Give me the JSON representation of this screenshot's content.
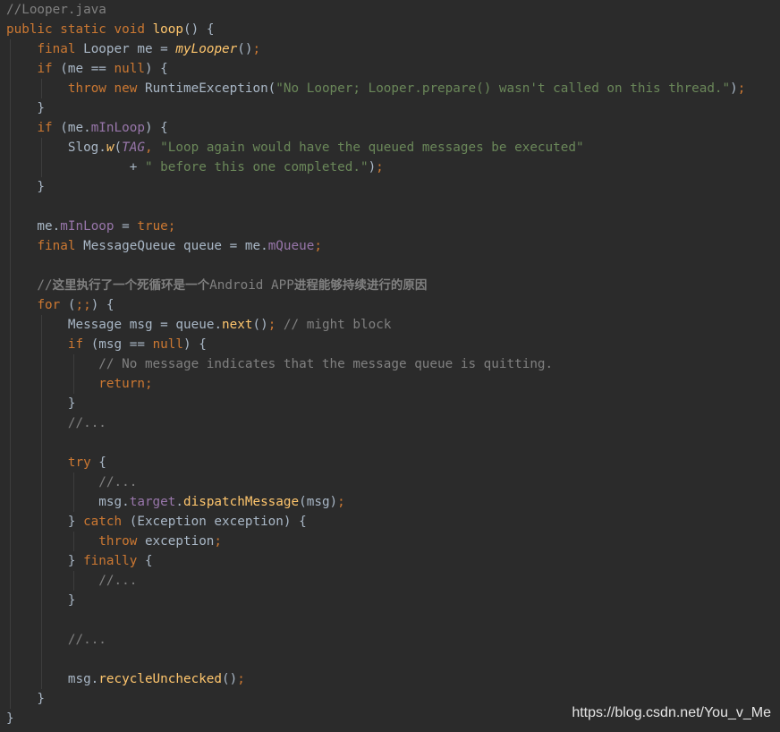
{
  "editor": {
    "file_comment": "//Looper.java",
    "lines": [
      [
        [
          "//Looper.java",
          "cm"
        ]
      ],
      [
        [
          "public",
          "kw"
        ],
        [
          " ",
          "p"
        ],
        [
          "static",
          "kw"
        ],
        [
          " ",
          "p"
        ],
        [
          "void",
          "kw"
        ],
        [
          " ",
          "p"
        ],
        [
          "loop",
          "fn"
        ],
        [
          "() {",
          "p"
        ]
      ],
      [
        [
          "    ",
          "p"
        ],
        [
          "final",
          "kw"
        ],
        [
          " Looper ",
          "cls"
        ],
        [
          "me",
          "lv"
        ],
        [
          " = ",
          "p"
        ],
        [
          "myLooper",
          "fni"
        ],
        [
          "()",
          "p"
        ],
        [
          ";",
          "kw"
        ]
      ],
      [
        [
          "    ",
          "p"
        ],
        [
          "if",
          "kw"
        ],
        [
          " (me == ",
          "p"
        ],
        [
          "null",
          "kw"
        ],
        [
          ") {",
          "p"
        ]
      ],
      [
        [
          "        ",
          "p"
        ],
        [
          "throw",
          "kw"
        ],
        [
          " ",
          "p"
        ],
        [
          "new",
          "kw"
        ],
        [
          " RuntimeException(",
          "p"
        ],
        [
          "\"No Looper; Looper.prepare() wasn't called on this thread.\"",
          "str"
        ],
        [
          ")",
          "p"
        ],
        [
          ";",
          "kw"
        ]
      ],
      [
        [
          "    }",
          "p"
        ]
      ],
      [
        [
          "    ",
          "p"
        ],
        [
          "if",
          "kw"
        ],
        [
          " (me.",
          "p"
        ],
        [
          "mInLoop",
          "fld"
        ],
        [
          ") {",
          "p"
        ]
      ],
      [
        [
          "        Slog.",
          "p"
        ],
        [
          "w",
          "fni"
        ],
        [
          "(",
          "p"
        ],
        [
          "TAG",
          "sti"
        ],
        [
          ",",
          "kw"
        ],
        [
          " ",
          "p"
        ],
        [
          "\"Loop again would have the queued messages be executed\"",
          "str"
        ]
      ],
      [
        [
          "                + ",
          "p"
        ],
        [
          "\" before this one completed.\"",
          "str"
        ],
        [
          ")",
          "p"
        ],
        [
          ";",
          "kw"
        ]
      ],
      [
        [
          "    }",
          "p"
        ]
      ],
      [
        [
          "",
          "p"
        ]
      ],
      [
        [
          "    me.",
          "p"
        ],
        [
          "mInLoop",
          "fld"
        ],
        [
          " = ",
          "p"
        ],
        [
          "true",
          "kw"
        ],
        [
          ";",
          "kw"
        ]
      ],
      [
        [
          "    ",
          "p"
        ],
        [
          "final",
          "kw"
        ],
        [
          " MessageQueue ",
          "cls"
        ],
        [
          "queue",
          "lv"
        ],
        [
          " = me.",
          "p"
        ],
        [
          "mQueue",
          "fld"
        ],
        [
          ";",
          "kw"
        ]
      ],
      [
        [
          "",
          "p"
        ]
      ],
      [
        [
          "    //",
          "cm"
        ],
        [
          "这里执行了一个死循环是一个",
          "cmb"
        ],
        [
          "Android APP",
          "cm"
        ],
        [
          "进程能够持续进行的原因",
          "cmb"
        ]
      ],
      [
        [
          "    ",
          "p"
        ],
        [
          "for",
          "kw"
        ],
        [
          " (",
          "p"
        ],
        [
          ";;",
          "kw"
        ],
        [
          ") {",
          "p"
        ]
      ],
      [
        [
          "        Message ",
          "cls"
        ],
        [
          "msg",
          "lv"
        ],
        [
          " = ",
          "p"
        ],
        [
          "queue",
          "lv"
        ],
        [
          ".",
          "p"
        ],
        [
          "next",
          "fn"
        ],
        [
          "()",
          "p"
        ],
        [
          ";",
          "kw"
        ],
        [
          " ",
          "p"
        ],
        [
          "// might block",
          "cm"
        ]
      ],
      [
        [
          "        ",
          "p"
        ],
        [
          "if",
          "kw"
        ],
        [
          " (msg == ",
          "p"
        ],
        [
          "null",
          "kw"
        ],
        [
          ") {",
          "p"
        ]
      ],
      [
        [
          "            ",
          "p"
        ],
        [
          "// No message indicates that the message queue is quitting.",
          "cm"
        ]
      ],
      [
        [
          "            ",
          "p"
        ],
        [
          "return",
          "kw"
        ],
        [
          ";",
          "kw"
        ]
      ],
      [
        [
          "        }",
          "p"
        ]
      ],
      [
        [
          "        ",
          "p"
        ],
        [
          "//...",
          "cm"
        ]
      ],
      [
        [
          "",
          "p"
        ]
      ],
      [
        [
          "        ",
          "p"
        ],
        [
          "try",
          "kw"
        ],
        [
          " {",
          "p"
        ]
      ],
      [
        [
          "            ",
          "p"
        ],
        [
          "//...",
          "cm"
        ]
      ],
      [
        [
          "            msg.",
          "p"
        ],
        [
          "target",
          "fld"
        ],
        [
          ".",
          "p"
        ],
        [
          "dispatchMessage",
          "fn"
        ],
        [
          "(msg)",
          "p"
        ],
        [
          ";",
          "kw"
        ]
      ],
      [
        [
          "        } ",
          "p"
        ],
        [
          "catch",
          "kw"
        ],
        [
          " (Exception ",
          "p"
        ],
        [
          "exception",
          "lv"
        ],
        [
          ") {",
          "p"
        ]
      ],
      [
        [
          "            ",
          "p"
        ],
        [
          "throw",
          "kw"
        ],
        [
          " exception",
          "p"
        ],
        [
          ";",
          "kw"
        ]
      ],
      [
        [
          "        } ",
          "p"
        ],
        [
          "finally",
          "kw"
        ],
        [
          " {",
          "p"
        ]
      ],
      [
        [
          "            ",
          "p"
        ],
        [
          "//...",
          "cm"
        ]
      ],
      [
        [
          "        }",
          "p"
        ]
      ],
      [
        [
          "",
          "p"
        ]
      ],
      [
        [
          "        ",
          "p"
        ],
        [
          "//...",
          "cm"
        ]
      ],
      [
        [
          "",
          "p"
        ]
      ],
      [
        [
          "        msg.",
          "p"
        ],
        [
          "recycleUnchecked",
          "fn"
        ],
        [
          "()",
          "p"
        ],
        [
          ";",
          "kw"
        ]
      ],
      [
        [
          "    }",
          "p"
        ]
      ],
      [
        [
          "}",
          "p"
        ]
      ]
    ]
  },
  "watermark": "https://blog.csdn.net/You_v_Me",
  "colors": {
    "background": "#2b2b2b",
    "keyword": "#cc7832",
    "comment": "#808080",
    "string": "#6a8759",
    "method": "#ffc66d",
    "field": "#9876aa",
    "plain": "#a9b7c6"
  }
}
